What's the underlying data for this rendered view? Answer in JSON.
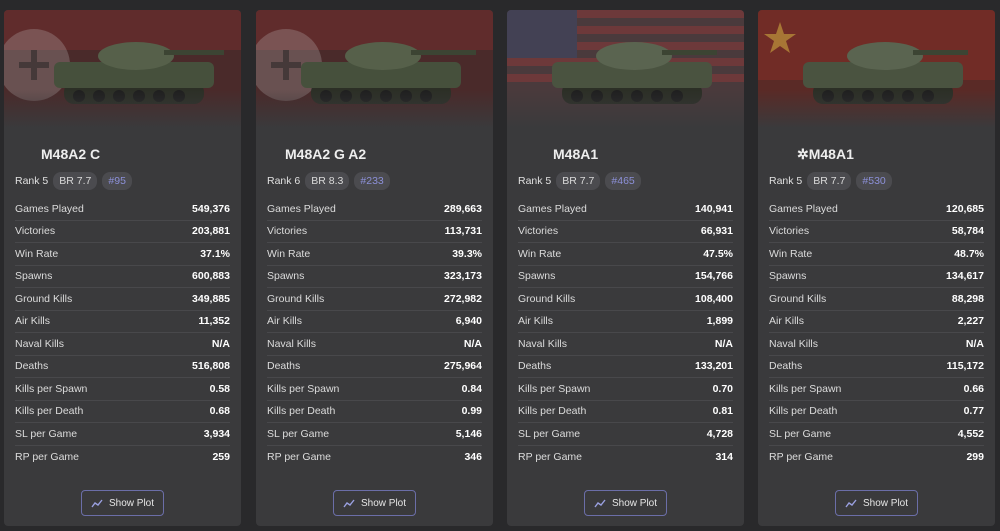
{
  "vehicles": [
    {
      "name": "M48A2 C",
      "flag": "germany",
      "rank": "Rank 5",
      "br": "BR 7.7",
      "index": "#95",
      "stats": [
        {
          "label": "Games Played",
          "value": "549,376"
        },
        {
          "label": "Victories",
          "value": "203,881"
        },
        {
          "label": "Win Rate",
          "value": "37.1%"
        },
        {
          "label": "Spawns",
          "value": "600,883"
        },
        {
          "label": "Ground Kills",
          "value": "349,885"
        },
        {
          "label": "Air Kills",
          "value": "11,352"
        },
        {
          "label": "Naval Kills",
          "value": "N/A"
        },
        {
          "label": "Deaths",
          "value": "516,808"
        },
        {
          "label": "Kills per Spawn",
          "value": "0.58"
        },
        {
          "label": "Kills per Death",
          "value": "0.68"
        },
        {
          "label": "SL per Game",
          "value": "3,934"
        },
        {
          "label": "RP per Game",
          "value": "259"
        }
      ],
      "button": "Show Plot"
    },
    {
      "name": "M48A2 G A2",
      "flag": "germany",
      "rank": "Rank 6",
      "br": "BR 8.3",
      "index": "#233",
      "stats": [
        {
          "label": "Games Played",
          "value": "289,663"
        },
        {
          "label": "Victories",
          "value": "113,731"
        },
        {
          "label": "Win Rate",
          "value": "39.3%"
        },
        {
          "label": "Spawns",
          "value": "323,173"
        },
        {
          "label": "Ground Kills",
          "value": "272,982"
        },
        {
          "label": "Air Kills",
          "value": "6,940"
        },
        {
          "label": "Naval Kills",
          "value": "N/A"
        },
        {
          "label": "Deaths",
          "value": "275,964"
        },
        {
          "label": "Kills per Spawn",
          "value": "0.84"
        },
        {
          "label": "Kills per Death",
          "value": "0.99"
        },
        {
          "label": "SL per Game",
          "value": "5,146"
        },
        {
          "label": "RP per Game",
          "value": "346"
        }
      ],
      "button": "Show Plot"
    },
    {
      "name": "M48A1",
      "flag": "usa",
      "rank": "Rank 5",
      "br": "BR 7.7",
      "index": "#465",
      "stats": [
        {
          "label": "Games Played",
          "value": "140,941"
        },
        {
          "label": "Victories",
          "value": "66,931"
        },
        {
          "label": "Win Rate",
          "value": "47.5%"
        },
        {
          "label": "Spawns",
          "value": "154,766"
        },
        {
          "label": "Ground Kills",
          "value": "108,400"
        },
        {
          "label": "Air Kills",
          "value": "1,899"
        },
        {
          "label": "Naval Kills",
          "value": "N/A"
        },
        {
          "label": "Deaths",
          "value": "133,201"
        },
        {
          "label": "Kills per Spawn",
          "value": "0.70"
        },
        {
          "label": "Kills per Death",
          "value": "0.81"
        },
        {
          "label": "SL per Game",
          "value": "4,728"
        },
        {
          "label": "RP per Game",
          "value": "314"
        }
      ],
      "button": "Show Plot"
    },
    {
      "name": "M48A1",
      "name_prefix": "✲",
      "flag": "china",
      "rank": "Rank 5",
      "br": "BR 7.7",
      "index": "#530",
      "stats": [
        {
          "label": "Games Played",
          "value": "120,685"
        },
        {
          "label": "Victories",
          "value": "58,784"
        },
        {
          "label": "Win Rate",
          "value": "48.7%"
        },
        {
          "label": "Spawns",
          "value": "134,617"
        },
        {
          "label": "Ground Kills",
          "value": "88,298"
        },
        {
          "label": "Air Kills",
          "value": "2,227"
        },
        {
          "label": "Naval Kills",
          "value": "N/A"
        },
        {
          "label": "Deaths",
          "value": "115,172"
        },
        {
          "label": "Kills per Spawn",
          "value": "0.66"
        },
        {
          "label": "Kills per Death",
          "value": "0.77"
        },
        {
          "label": "SL per Game",
          "value": "4,552"
        },
        {
          "label": "RP per Game",
          "value": "299"
        }
      ],
      "button": "Show Plot"
    }
  ],
  "icons": {
    "button_icon": "line-chart-icon"
  },
  "colors": {
    "accent": "#8c90d8",
    "card_bg": "#3a3a3c",
    "page_bg": "#29292b"
  }
}
